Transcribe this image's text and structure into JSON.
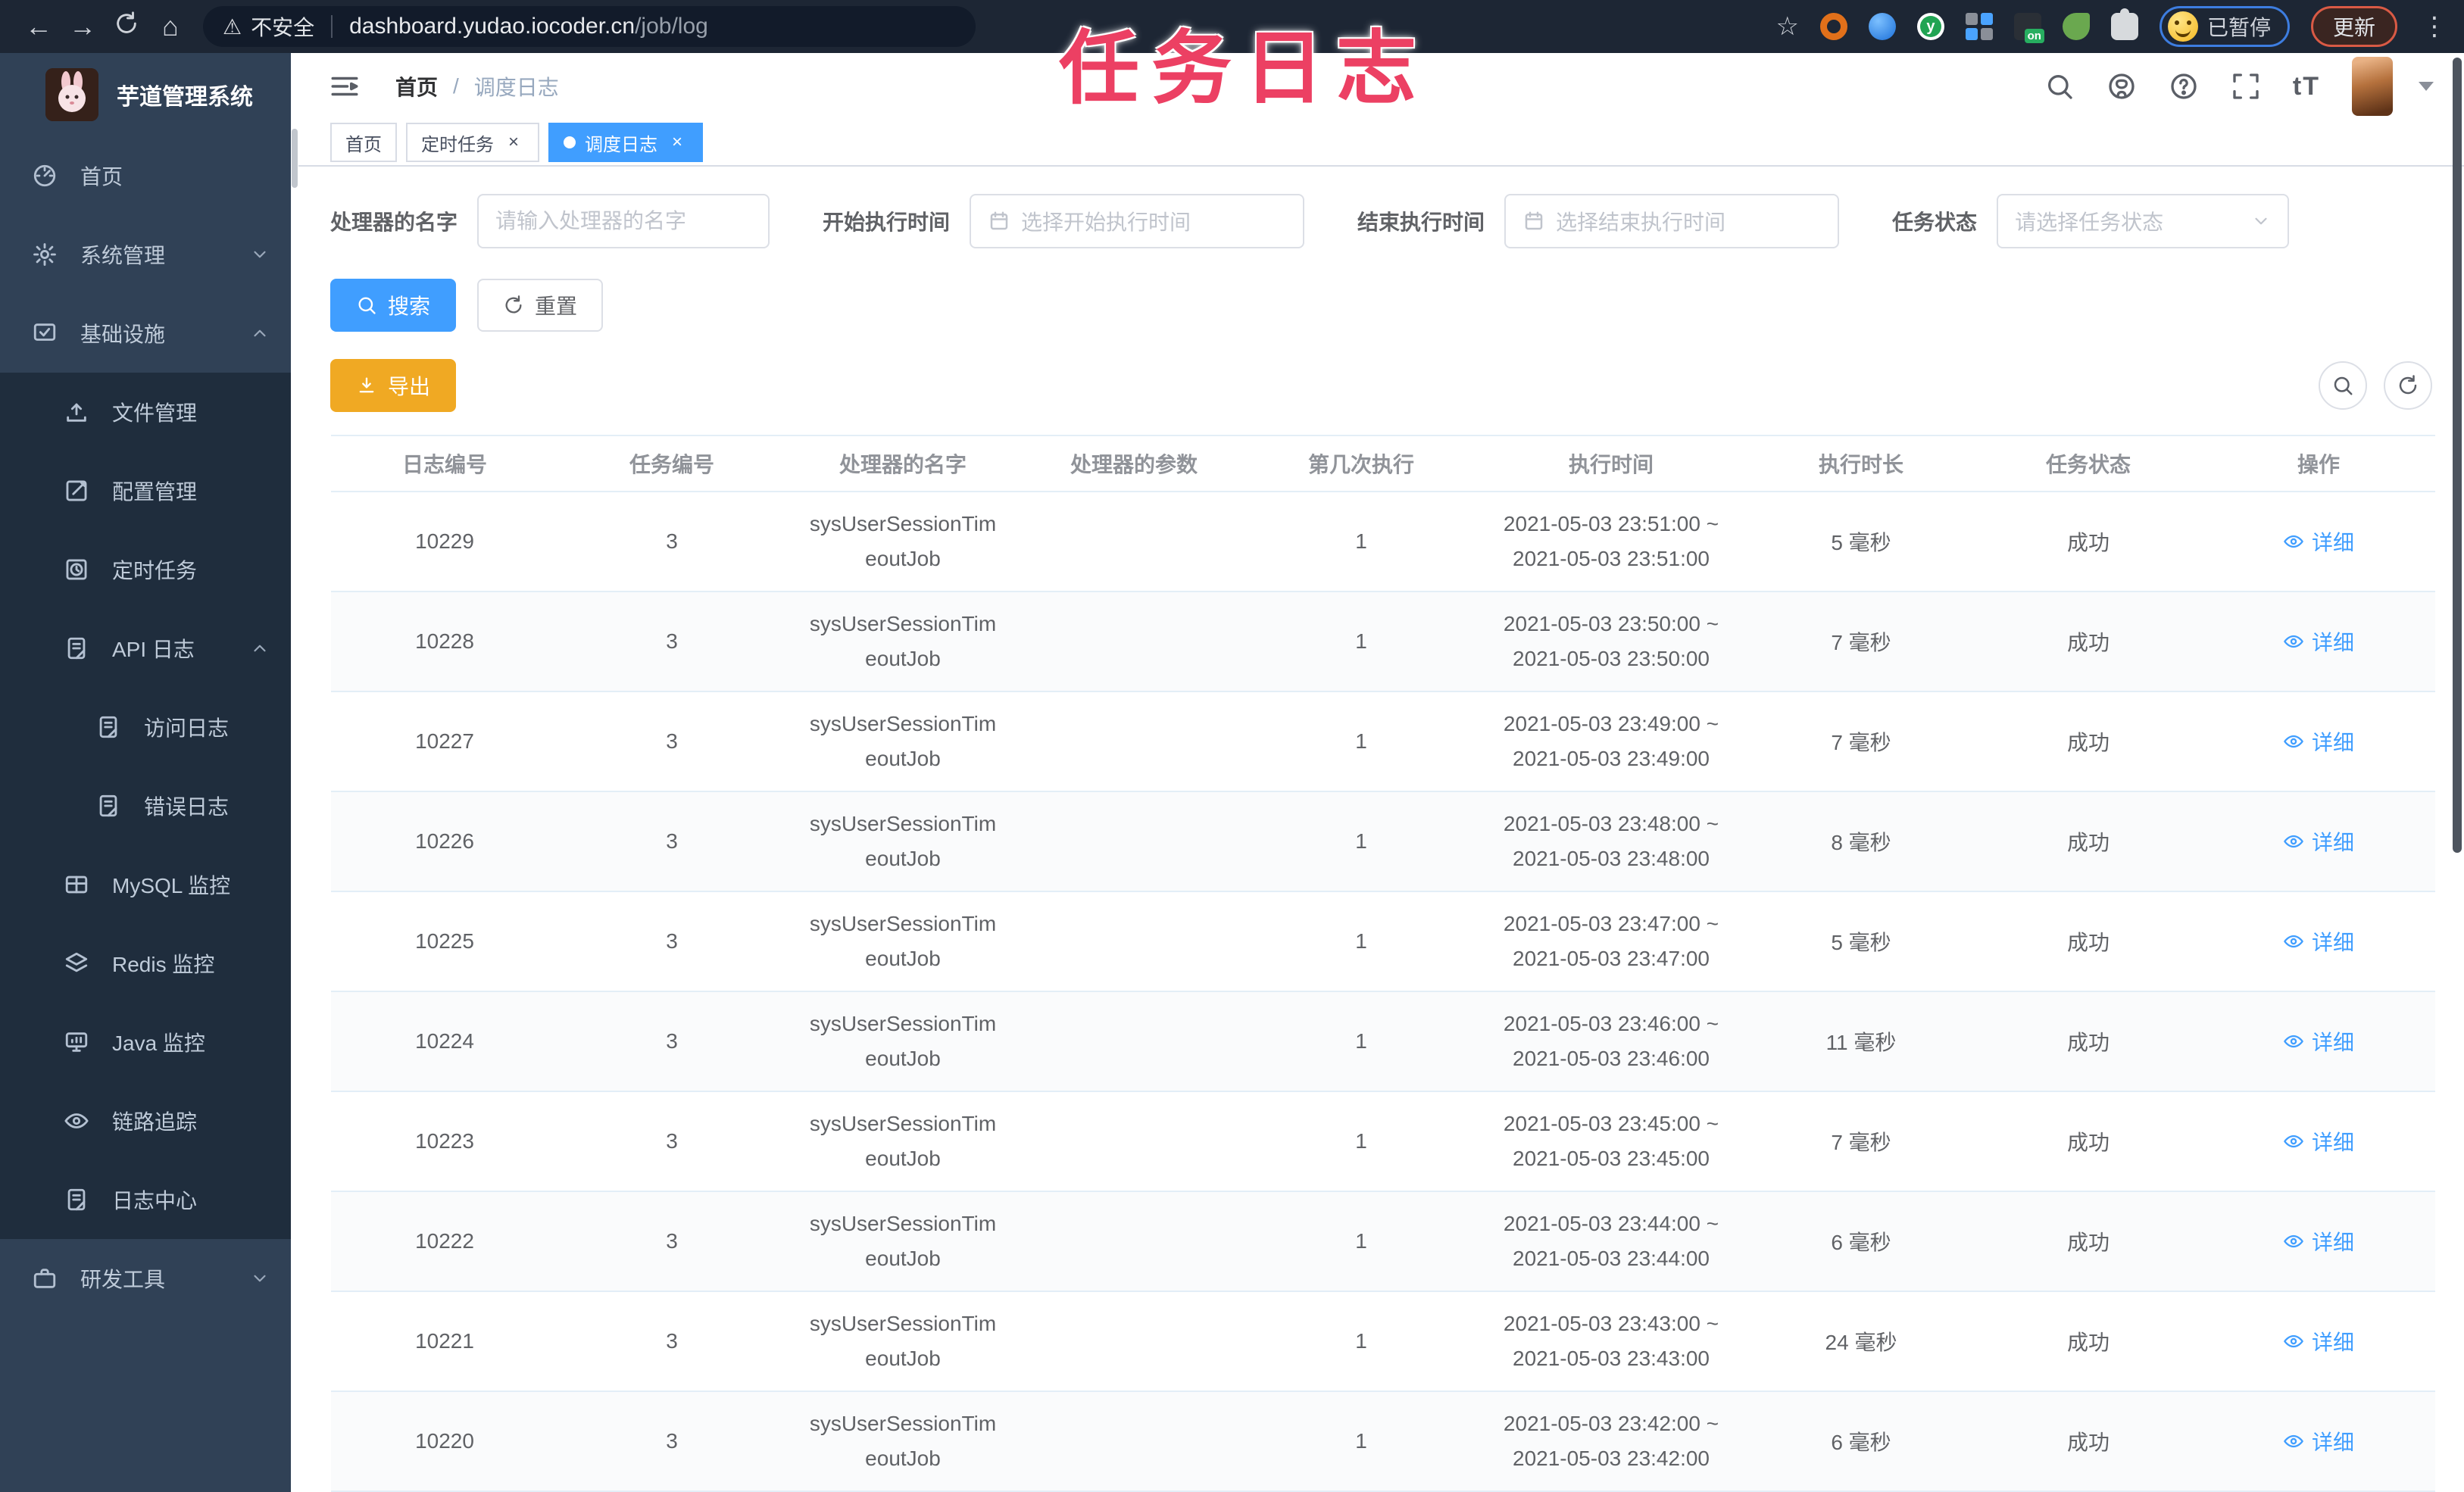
{
  "palette": {
    "accent": "#409eff",
    "warning_button": "#f0a923",
    "sidebar_bg": "#304156",
    "submenu_bg": "#1f2d3d",
    "overlay_pink": "#ec4063",
    "active_tag": "#409eff"
  },
  "overlay_title": "任务日志",
  "browser": {
    "security_label": "不安全",
    "url_main": "dashboard.yudao.iocoder.cn",
    "url_path": "/job/log",
    "paused_label": "已暂停",
    "update_label": "更新"
  },
  "sidebar": {
    "app_title": "芋道管理系统",
    "items": [
      {
        "label": "首页",
        "icon": "dashboard-icon"
      },
      {
        "label": "系统管理",
        "icon": "gear-icon",
        "chevron": "down"
      },
      {
        "label": "基础设施",
        "icon": "infrastructure-icon",
        "chevron": "up"
      },
      {
        "label": "文件管理",
        "icon": "upload-icon"
      },
      {
        "label": "配置管理",
        "icon": "edit-icon"
      },
      {
        "label": "定时任务",
        "icon": "clock-icon"
      },
      {
        "label": "API 日志",
        "icon": "log-icon",
        "chevron": "up"
      },
      {
        "label": "访问日志",
        "icon": "log-icon"
      },
      {
        "label": "错误日志",
        "icon": "log-icon"
      },
      {
        "label": "MySQL 监控",
        "icon": "table-grid-icon"
      },
      {
        "label": "Redis 监控",
        "icon": "layers-icon"
      },
      {
        "label": "Java 监控",
        "icon": "monitor-icon"
      },
      {
        "label": "链路追踪",
        "icon": "eye-icon"
      },
      {
        "label": "日志中心",
        "icon": "log-icon"
      },
      {
        "label": "研发工具",
        "icon": "briefcase-icon",
        "chevron": "down"
      }
    ]
  },
  "header": {
    "breadcrumb": {
      "home": "首页",
      "separator": "/",
      "current": "调度日志"
    }
  },
  "tags": [
    {
      "label": "首页"
    },
    {
      "label": "定时任务",
      "close": "×"
    },
    {
      "label": "调度日志",
      "close": "×"
    }
  ],
  "filters": {
    "handler": {
      "label": "处理器的名字",
      "placeholder": "请输入处理器的名字"
    },
    "start": {
      "label": "开始执行时间",
      "placeholder": "选择开始执行时间"
    },
    "end": {
      "label": "结束执行时间",
      "placeholder": "选择结束执行时间"
    },
    "status": {
      "label": "任务状态",
      "placeholder": "请选择任务状态"
    }
  },
  "buttons": {
    "search": "搜索",
    "reset": "重置",
    "export": "导出"
  },
  "table": {
    "columns": [
      "日志编号",
      "任务编号",
      "处理器的名字",
      "处理器的参数",
      "第几次执行",
      "执行时间",
      "执行时长",
      "任务状态",
      "操作"
    ],
    "rows": [
      {
        "log_id": "10229",
        "job_id": "3",
        "handler_line1": "sysUserSessionTim",
        "handler_line2": "eoutJob",
        "param": "",
        "execute_index": "1",
        "time_line1": "2021-05-03 23:51:00 ~",
        "time_line2": "2021-05-03 23:51:00",
        "duration": "5 毫秒",
        "status": "成功",
        "action": "详细"
      },
      {
        "log_id": "10228",
        "job_id": "3",
        "handler_line1": "sysUserSessionTim",
        "handler_line2": "eoutJob",
        "param": "",
        "execute_index": "1",
        "time_line1": "2021-05-03 23:50:00 ~",
        "time_line2": "2021-05-03 23:50:00",
        "duration": "7 毫秒",
        "status": "成功",
        "action": "详细"
      },
      {
        "log_id": "10227",
        "job_id": "3",
        "handler_line1": "sysUserSessionTim",
        "handler_line2": "eoutJob",
        "param": "",
        "execute_index": "1",
        "time_line1": "2021-05-03 23:49:00 ~",
        "time_line2": "2021-05-03 23:49:00",
        "duration": "7 毫秒",
        "status": "成功",
        "action": "详细"
      },
      {
        "log_id": "10226",
        "job_id": "3",
        "handler_line1": "sysUserSessionTim",
        "handler_line2": "eoutJob",
        "param": "",
        "execute_index": "1",
        "time_line1": "2021-05-03 23:48:00 ~",
        "time_line2": "2021-05-03 23:48:00",
        "duration": "8 毫秒",
        "status": "成功",
        "action": "详细"
      },
      {
        "log_id": "10225",
        "job_id": "3",
        "handler_line1": "sysUserSessionTim",
        "handler_line2": "eoutJob",
        "param": "",
        "execute_index": "1",
        "time_line1": "2021-05-03 23:47:00 ~",
        "time_line2": "2021-05-03 23:47:00",
        "duration": "5 毫秒",
        "status": "成功",
        "action": "详细"
      },
      {
        "log_id": "10224",
        "job_id": "3",
        "handler_line1": "sysUserSessionTim",
        "handler_line2": "eoutJob",
        "param": "",
        "execute_index": "1",
        "time_line1": "2021-05-03 23:46:00 ~",
        "time_line2": "2021-05-03 23:46:00",
        "duration": "11 毫秒",
        "status": "成功",
        "action": "详细"
      },
      {
        "log_id": "10223",
        "job_id": "3",
        "handler_line1": "sysUserSessionTim",
        "handler_line2": "eoutJob",
        "param": "",
        "execute_index": "1",
        "time_line1": "2021-05-03 23:45:00 ~",
        "time_line2": "2021-05-03 23:45:00",
        "duration": "7 毫秒",
        "status": "成功",
        "action": "详细"
      },
      {
        "log_id": "10222",
        "job_id": "3",
        "handler_line1": "sysUserSessionTim",
        "handler_line2": "eoutJob",
        "param": "",
        "execute_index": "1",
        "time_line1": "2021-05-03 23:44:00 ~",
        "time_line2": "2021-05-03 23:44:00",
        "duration": "6 毫秒",
        "status": "成功",
        "action": "详细"
      },
      {
        "log_id": "10221",
        "job_id": "3",
        "handler_line1": "sysUserSessionTim",
        "handler_line2": "eoutJob",
        "param": "",
        "execute_index": "1",
        "time_line1": "2021-05-03 23:43:00 ~",
        "time_line2": "2021-05-03 23:43:00",
        "duration": "24 毫秒",
        "status": "成功",
        "action": "详细"
      },
      {
        "log_id": "10220",
        "job_id": "3",
        "handler_line1": "sysUserSessionTim",
        "handler_line2": "eoutJob",
        "param": "",
        "execute_index": "1",
        "time_line1": "2021-05-03 23:42:00 ~",
        "time_line2": "2021-05-03 23:42:00",
        "duration": "6 毫秒",
        "status": "成功",
        "action": "详细"
      }
    ]
  }
}
